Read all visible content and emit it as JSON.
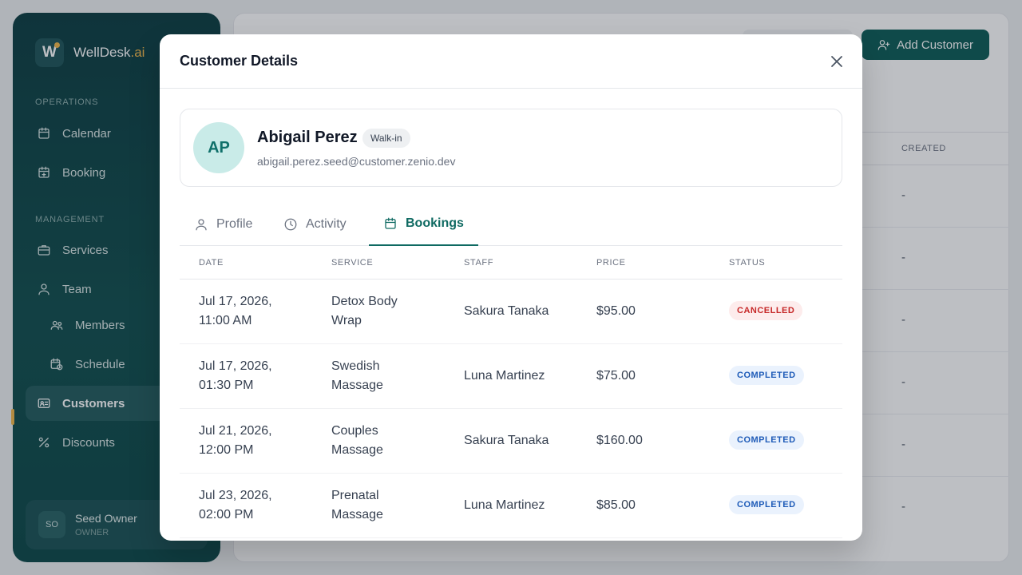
{
  "brand": {
    "logo_letter": "W",
    "name_main": "WellDesk",
    "name_suffix": ".ai",
    "accent": "#f2b84b"
  },
  "sidebar": {
    "sections": {
      "operations": "OPERATIONS",
      "management": "MANAGEMENT"
    },
    "items": [
      {
        "label": "Calendar",
        "icon": "calendar-icon"
      },
      {
        "label": "Booking",
        "icon": "calendar-plus-icon"
      },
      {
        "label": "Services",
        "icon": "briefcase-icon"
      },
      {
        "label": "Team",
        "icon": "user-icon"
      },
      {
        "label": "Members",
        "icon": "users-icon"
      },
      {
        "label": "Schedule",
        "icon": "calendar-clock-icon"
      },
      {
        "label": "Customers",
        "icon": "id-card-icon"
      },
      {
        "label": "Discounts",
        "icon": "percent-icon"
      }
    ],
    "user": {
      "initials": "SO",
      "name": "Seed Owner",
      "role": "OWNER"
    }
  },
  "main": {
    "add_button_label": "Add Customer",
    "table_header_created": "CREATED",
    "row_placeholder": "-"
  },
  "modal": {
    "title": "Customer Details",
    "customer": {
      "initials": "AP",
      "name": "Abigail Perez",
      "badge": "Walk-in",
      "email": "abigail.perez.seed@customer.zenio.dev"
    },
    "tabs": [
      {
        "label": "Profile",
        "icon": "user-icon"
      },
      {
        "label": "Activity",
        "icon": "clock-icon"
      },
      {
        "label": "Bookings",
        "icon": "calendar-icon"
      }
    ],
    "active_tab": "Bookings",
    "bookings": {
      "columns": [
        "DATE",
        "SERVICE",
        "STAFF",
        "PRICE",
        "STATUS"
      ],
      "rows": [
        {
          "date_line1": "Jul 17, 2026,",
          "date_line2": "11:00 AM",
          "service_line1": "Detox Body",
          "service_line2": "Wrap",
          "staff": "Sakura Tanaka",
          "price": "$95.00",
          "status": "CANCELLED"
        },
        {
          "date_line1": "Jul 17, 2026,",
          "date_line2": "01:30 PM",
          "service_line1": "Swedish",
          "service_line2": "Massage",
          "staff": "Luna Martinez",
          "price": "$75.00",
          "status": "COMPLETED"
        },
        {
          "date_line1": "Jul 21, 2026,",
          "date_line2": "12:00 PM",
          "service_line1": "Couples",
          "service_line2": "Massage",
          "staff": "Sakura Tanaka",
          "price": "$160.00",
          "status": "COMPLETED"
        },
        {
          "date_line1": "Jul 23, 2026,",
          "date_line2": "02:00 PM",
          "service_line1": "Prenatal",
          "service_line2": "Massage",
          "staff": "Luna Martinez",
          "price": "$85.00",
          "status": "COMPLETED"
        }
      ]
    }
  },
  "colors": {
    "primary": "#0f5d58",
    "cancelled": "#c62828",
    "completed": "#1e5bb8"
  }
}
